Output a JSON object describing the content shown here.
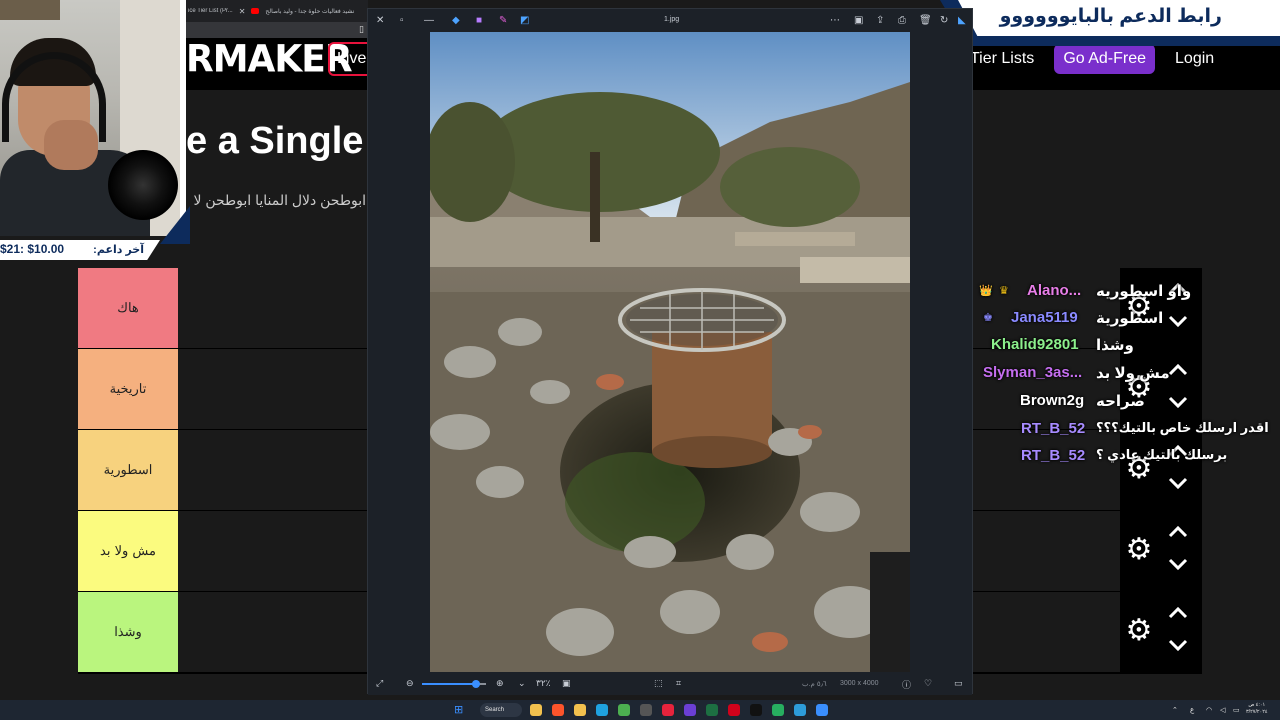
{
  "browser": {
    "tabs": [
      {
        "label": "ice Tier List (Pr...",
        "icon": "tiermaker-favicon"
      },
      {
        "label": "نشيد فعاليات حلوة جدا - وليد باصالح",
        "icon": "youtube-icon",
        "color": "#ff0000"
      }
    ],
    "bookmark_icon": "bookmark-icon"
  },
  "site": {
    "logo": "RMAKER",
    "live_label": "Live",
    "nav": {
      "tier_lists": "Tier Lists",
      "go_ad_free": "Go Ad-Free",
      "login": "Login"
    },
    "heading": "e a Single",
    "description": "ابوطحن دلال المنايا ابوطحن لا",
    "accent_purple": "#7a2fcc",
    "accent_red": "#e8123c"
  },
  "tiers": [
    {
      "label": "هاك",
      "color": "#f07a82"
    },
    {
      "label": "تاريخية",
      "color": "#f5b07f"
    },
    {
      "label": "اسطورية",
      "color": "#f7d27e"
    },
    {
      "label": "مش ولا بد",
      "color": "#fbfb7f"
    },
    {
      "label": "وشذا",
      "color": "#baf57e"
    }
  ],
  "tier_controls": {
    "gear_icon": "gear-icon",
    "up_icon": "chevron-up-icon",
    "down_icon": "chevron-down-icon"
  },
  "chat": [
    {
      "user": "Alano...",
      "color": "#e87ee8",
      "badges": [
        "crown-badge",
        "prime-badge"
      ],
      "message": "واو اسطوريه"
    },
    {
      "user": "Jana5119",
      "color": "#8a8aff",
      "badges": [
        "prime-badge"
      ],
      "message": "اسطورية"
    },
    {
      "user": "Khalid92801",
      "color": "#8cf08c",
      "badges": [],
      "message": "وشذا"
    },
    {
      "user": "Slyman_3as...",
      "color": "#c56ef0",
      "badges": [],
      "message": "مش ولا بد"
    },
    {
      "user": "Brown2g",
      "color": "#ffffff",
      "badges": [],
      "message": "صراحه"
    },
    {
      "user": "RT_B_52",
      "color": "#a78bff",
      "badges": [],
      "message": "اقدر ارسلك خاص بالتيك؟؟؟"
    },
    {
      "user": "RT_B_52",
      "color": "#a78bff",
      "badges": [],
      "message": "برسلك بالتيك عادي ؟"
    }
  ],
  "donor": {
    "label": "آخر داعم:",
    "amount": "$21: $10.00"
  },
  "banner": {
    "text": "رابط الدعم بالبايوووووو",
    "color": "#0d2b5c"
  },
  "viewer": {
    "filename": "1.jpg",
    "title_icons": [
      "close-icon",
      "maximize-icon",
      "minimize-icon",
      "edit-icon",
      "filter-icon",
      "draw-icon",
      "erase-icon"
    ],
    "right_icons": [
      "more-icon",
      "slideshow-icon",
      "share-icon",
      "print-icon",
      "delete-icon",
      "rotate-icon",
      "onedrive-icon"
    ],
    "zoom_percent": "٣٢٪",
    "dimensions": "3000 x 4000",
    "size": "٥٫٦ م.ب",
    "zoom_fill": 0.85
  },
  "taskbar": {
    "search_label": "Search",
    "clock_time": "٤:٠١ ص",
    "clock_date": "٣/٢٧/٢٠٢٤",
    "language": "ع",
    "apps": [
      {
        "icon": "explorer-icon",
        "color": "#f2c14e"
      },
      {
        "icon": "brave-icon",
        "color": "#fb542b"
      },
      {
        "icon": "files-icon",
        "color": "#f2c14e"
      },
      {
        "icon": "edge-icon",
        "color": "#1fa2e0"
      },
      {
        "icon": "chrome-icon",
        "color": "#4caf50"
      },
      {
        "icon": "obs-icon",
        "color": "#555555"
      },
      {
        "icon": "opera-icon",
        "color": "#e6233c"
      },
      {
        "icon": "streamlabs-icon",
        "color": "#6b3fd4"
      },
      {
        "icon": "excel-icon",
        "color": "#1d6f42"
      },
      {
        "icon": "record-icon",
        "color": "#d0021b"
      },
      {
        "icon": "tiktok-icon",
        "color": "#111111"
      },
      {
        "icon": "game-icon",
        "color": "#27ae60"
      },
      {
        "icon": "notes-icon",
        "color": "#2d9cdb"
      },
      {
        "icon": "photos-icon",
        "color": "#3a8fff"
      }
    ]
  }
}
